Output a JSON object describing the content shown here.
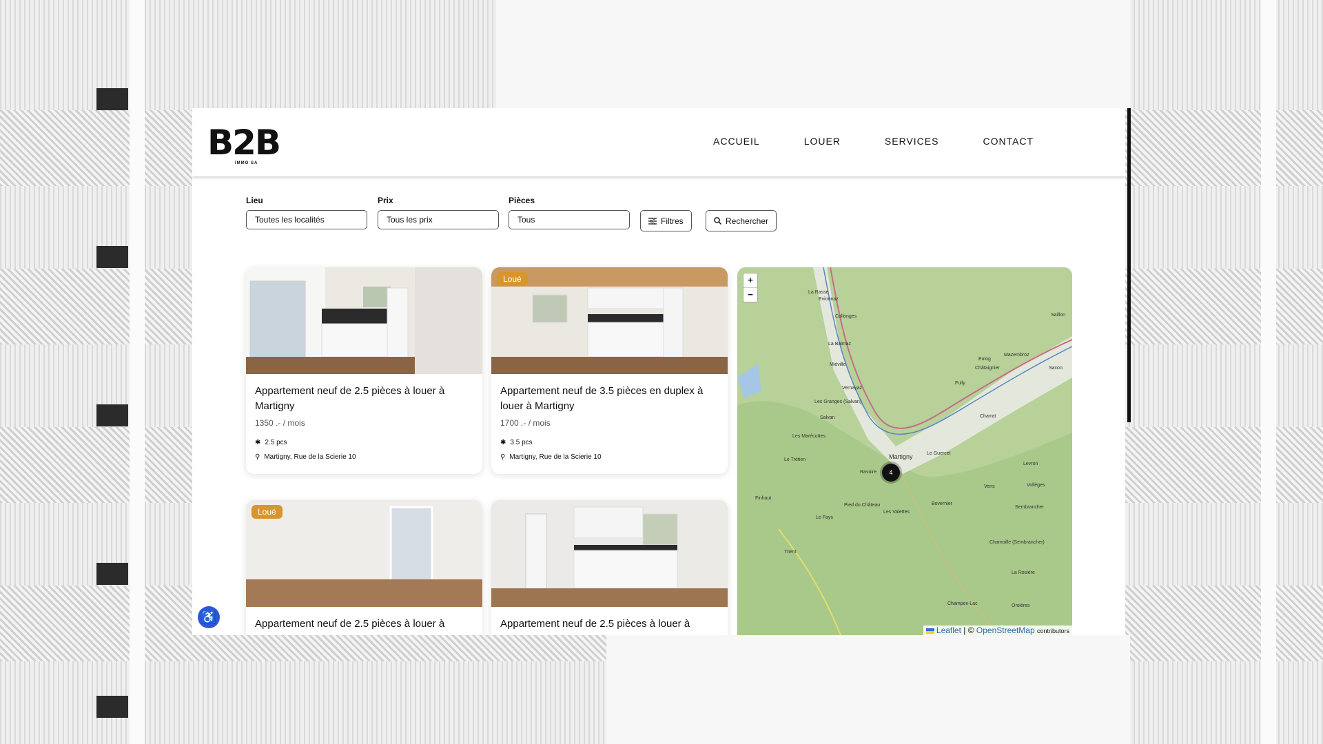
{
  "brand": {
    "logo_text": "B2B",
    "logo_sub": "IMMO SA"
  },
  "nav": {
    "items": [
      "ACCUEIL",
      "LOUER",
      "SERVICES",
      "CONTACT"
    ]
  },
  "filters": {
    "lieu": {
      "label": "Lieu",
      "value": "Toutes les localités"
    },
    "prix": {
      "label": "Prix",
      "value": "Tous les prix"
    },
    "pieces": {
      "label": "Pièces",
      "value": "Tous"
    },
    "filters_button": "Filtres",
    "search_button": "Rechercher"
  },
  "listings": [
    {
      "title": "Appartement neuf de 2.5 pièces à louer à Martigny",
      "price": "1350 .- / mois",
      "rooms": "2.5 pcs",
      "address": "Martigny, Rue de la Scierie 10",
      "badge": ""
    },
    {
      "title": "Appartement neuf de 3.5 pièces en duplex à louer à Martigny",
      "price": "1700 .- / mois",
      "rooms": "3.5 pcs",
      "address": "Martigny, Rue de la Scierie 10",
      "badge": "Loué"
    },
    {
      "title": "Appartement neuf de 2.5 pièces à louer à",
      "badge": "Loué"
    },
    {
      "title": "Appartement neuf de 2.5 pièces à louer à",
      "badge": ""
    }
  ],
  "map": {
    "zoom_in": "+",
    "zoom_out": "−",
    "cluster_count": "4",
    "attribution_leaflet": "Leaflet",
    "attribution_sep": "| ©",
    "attribution_osm": "OpenStreetMap",
    "attribution_contrib": "contributors",
    "places": [
      "La Rasse",
      "Evionnaz",
      "Collonges",
      "La Balmaz",
      "Miéville",
      "Vernayaz",
      "Les Granges (Salvan)",
      "Salvan",
      "Les Marécottes",
      "Le Trétien",
      "Finhaut",
      "Martigny",
      "Ravoire",
      "Le Guercet",
      "Charrat",
      "Fully",
      "Saxon",
      "Saillon",
      "Mazembroz",
      "Eulog",
      "Châtaignier",
      "Levron",
      "Vollèges",
      "Vens",
      "Sembrancher",
      "Bovernier",
      "Les Valettes",
      "Pied du Château",
      "Le Fays",
      "Trient",
      "Champex-Lac",
      "Orsières",
      "La Rosière",
      "Chamoille (Sembrancher)"
    ]
  },
  "colors": {
    "accent_badge": "#d7962c",
    "accessibility": "#2f56d8",
    "map_green": "#b9d39c"
  }
}
